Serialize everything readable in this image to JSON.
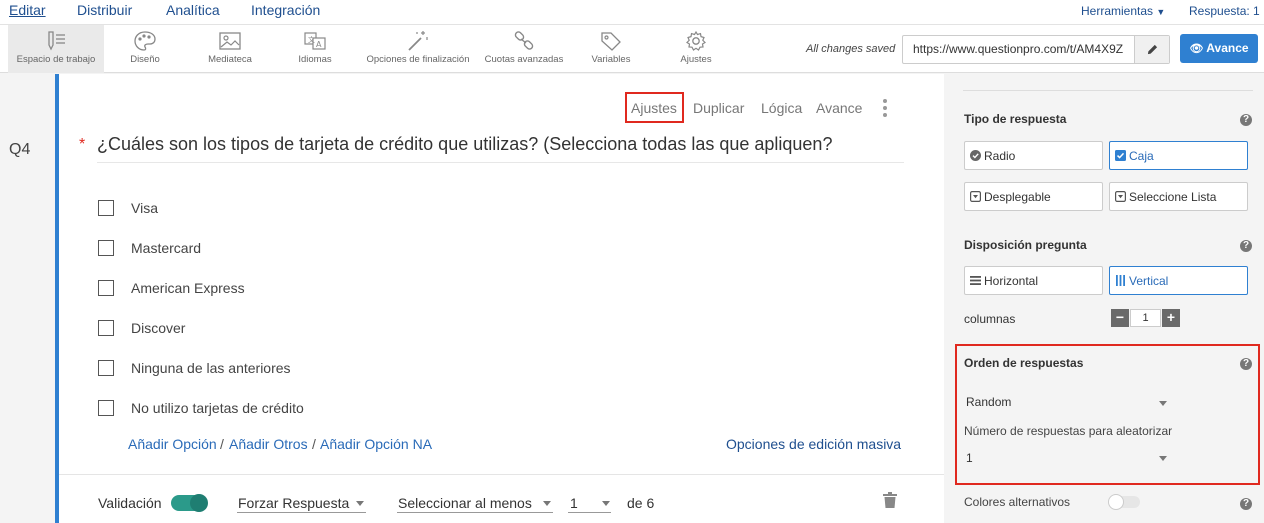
{
  "nav": {
    "tabs": [
      "Editar",
      "Distribuir",
      "Analítica",
      "Integración"
    ],
    "tools_menu": "Herramientas",
    "responses": "Respuesta: 1"
  },
  "toolbar": {
    "items": [
      {
        "label": "Espacio de trabajo",
        "icon": "workspace-icon"
      },
      {
        "label": "Diseño",
        "icon": "palette-icon"
      },
      {
        "label": "Mediateca",
        "icon": "image-icon"
      },
      {
        "label": "Idiomas",
        "icon": "translate-icon"
      },
      {
        "label": "Opciones de finalización",
        "icon": "magic-wand-icon"
      },
      {
        "label": "Cuotas avanzadas",
        "icon": "link-icon"
      },
      {
        "label": "Variables",
        "icon": "tag-icon"
      },
      {
        "label": "Ajustes",
        "icon": "gear-icon"
      }
    ],
    "saved_status": "All changes saved",
    "url": "https://www.questionpro.com/t/AM4X9Z",
    "avance_label": "Avance"
  },
  "question": {
    "number": "Q4",
    "required_marker": "*",
    "text": "¿Cuáles son los tipos de tarjeta de crédito que utilizas? (Selecciona todas las que apliquen?",
    "actions": [
      "Ajustes",
      "Duplicar",
      "Lógica",
      "Avance"
    ],
    "options": [
      "Visa",
      "Mastercard",
      "American Express",
      "Discover",
      "Ninguna de las anteriores",
      "No utilizo tarjetas de crédito"
    ],
    "add_links": [
      "Añadir Opción",
      "Añadir Otros",
      "Añadir Opción NA"
    ],
    "link_separator": "/",
    "bulk_edit": "Opciones de edición masiva"
  },
  "validation": {
    "label": "Validación",
    "enabled": true,
    "mode": "Forzar Respuesta",
    "rule": "Seleccionar al menos",
    "count": "1",
    "of_total": "de 6"
  },
  "panel": {
    "response_type": {
      "title": "Tipo de respuesta",
      "options": [
        "Radio",
        "Caja",
        "Desplegable",
        "Seleccione Lista"
      ],
      "selected": "Caja"
    },
    "layout": {
      "title": "Disposición pregunta",
      "options": [
        "Horizontal",
        "Vertical"
      ],
      "selected": "Vertical",
      "columns_label": "columnas",
      "columns_value": "1"
    },
    "order": {
      "title": "Orden de respuestas",
      "value": "Random",
      "randomize_label": "Número de respuestas para aleatorizar",
      "randomize_value": "1"
    },
    "alt_colors": {
      "label": "Colores alternativos",
      "enabled": false
    },
    "help_glyph": "?"
  },
  "colors": {
    "accent": "#2f80d1",
    "highlight": "#e0291f",
    "toggle_on": "#2b9a8a"
  }
}
